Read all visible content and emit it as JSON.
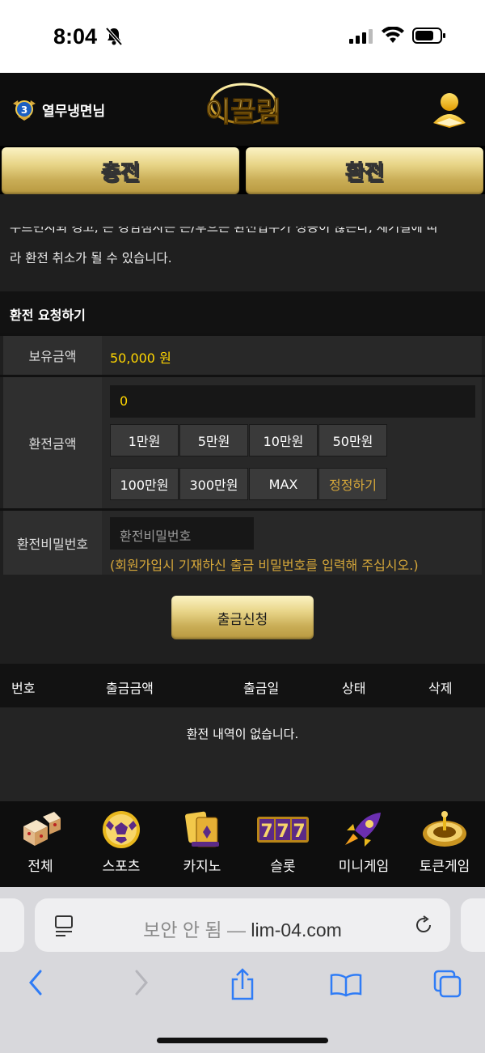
{
  "status_bar": {
    "time": "8:04"
  },
  "header": {
    "username": "열무냉면님",
    "logo_text": "이끌림"
  },
  "tabs": {
    "charge": "충전",
    "exchange": "환전"
  },
  "notice": {
    "line1_partial": "누르면시되 경고, 는 경임점사는 는/후으는 환전업무가 성공이 않는다, 세기결에 따",
    "line2": "라 환전 취소가 될 수 있습니다."
  },
  "section_title": "환전 요청하기",
  "form": {
    "balance_label": "보유금액",
    "balance_value": "50,000 원",
    "amount_label": "환전금액",
    "amount_value": "0",
    "quick_buttons": [
      "1만원",
      "5만원",
      "10만원",
      "50만원",
      "100만원",
      "300만원",
      "MAX",
      "정정하기"
    ],
    "password_label": "환전비밀번호",
    "password_placeholder": "환전비밀번호",
    "password_hint": "(회원가입시 기재하신 출금 비밀번호를 입력해 주십시오.)"
  },
  "submit_label": "출금신청",
  "table": {
    "headers": [
      "번호",
      "출금금액",
      "출금일",
      "상태",
      "삭제"
    ],
    "empty_message": "환전 내역이 없습니다."
  },
  "bottom_nav": [
    {
      "label": "전체",
      "icon": "dice-icon"
    },
    {
      "label": "스포츠",
      "icon": "soccer-ball-icon"
    },
    {
      "label": "카지노",
      "icon": "cards-icon"
    },
    {
      "label": "슬롯",
      "icon": "slot-777-icon"
    },
    {
      "label": "미니게임",
      "icon": "rocket-icon"
    },
    {
      "label": "토큰게임",
      "icon": "roulette-icon"
    }
  ],
  "browser": {
    "security_label": "보안 안 됨 —",
    "domain": "lim-04.com"
  },
  "colors": {
    "gold": "#e9d68a",
    "accent_yellow": "#ffd600",
    "hint_orange": "#d7a83a",
    "ios_blue": "#2f7cf6"
  }
}
